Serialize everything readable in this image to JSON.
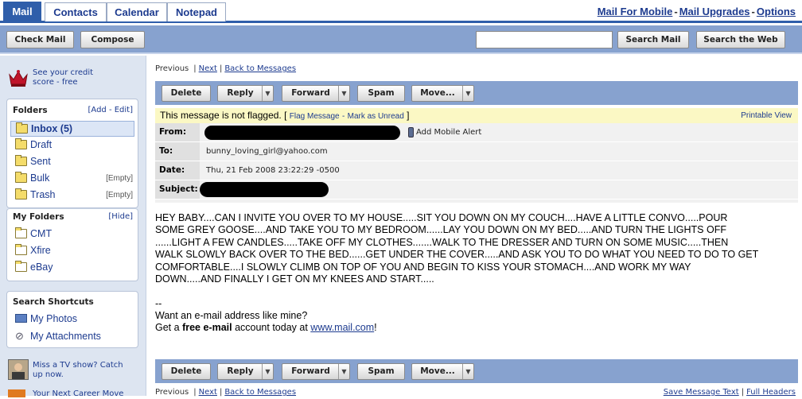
{
  "tabs": [
    "Mail",
    "Contacts",
    "Calendar",
    "Notepad"
  ],
  "top_links": {
    "mobile": "Mail For Mobile",
    "upgrades": "Mail Upgrades",
    "options": "Options",
    "sep": "-"
  },
  "toolbar": {
    "check": "Check Mail",
    "compose": "Compose",
    "search_mail": "Search Mail",
    "search_web": "Search the Web",
    "search_value": ""
  },
  "sidebar": {
    "promo_top": "See your credit score - free",
    "folders_title": "Folders",
    "folders_actions": "[Add - Edit]",
    "folders": [
      {
        "label": "Inbox (5)",
        "count": ""
      },
      {
        "label": "Draft",
        "count": ""
      },
      {
        "label": "Sent",
        "count": ""
      },
      {
        "label": "Bulk",
        "count": "[Empty]"
      },
      {
        "label": "Trash",
        "count": "[Empty]"
      }
    ],
    "my_folders_title": "My Folders",
    "my_folders_action": "[Hide]",
    "my_folders": [
      "CMT",
      "Xfire",
      "eBay"
    ],
    "shortcuts_title": "Search Shortcuts",
    "shortcuts": [
      "My Photos",
      "My Attachments"
    ],
    "promo_tv": "Miss a TV show? Catch up now.",
    "promo_career": "Your Next Career Move"
  },
  "nav": {
    "previous": "Previous",
    "next": "Next",
    "back": "Back to Messages",
    "sep": "|"
  },
  "actions": {
    "delete": "Delete",
    "reply": "Reply",
    "forward": "Forward",
    "spam": "Spam",
    "move": "Move..."
  },
  "flag": {
    "text": "This message is not flagged.",
    "open": "[",
    "flag_link": "Flag Message",
    "dash": "-",
    "unread_link": "Mark as Unread",
    "close": "]",
    "printable": "Printable View"
  },
  "headers": {
    "from_label": "From:",
    "mobile_alert": "Add Mobile Alert",
    "to_label": "To:",
    "to_value": "bunny_loving_girl@yahoo.com",
    "date_label": "Date:",
    "date_value": "Thu, 21 Feb 2008 23:22:29 -0500",
    "subject_label": "Subject:"
  },
  "body_lines": [
    "HEY BABY....CAN I INVITE YOU OVER TO MY HOUSE.....SIT YOU DOWN ON MY COUCH....HAVE A LITTLE CONVO.....POUR",
    "SOME GREY GOOSE....AND TAKE YOU TO MY BEDROOM......LAY YOU DOWN ON MY BED.....AND TURN THE LIGHTS OFF",
    "......LIGHT A FEW CANDLES.....TAKE OFF MY CLOTHES.......WALK TO THE DRESSER AND TURN ON SOME MUSIC.....THEN",
    "WALK SLOWLY BACK OVER TO THE BED......GET UNDER THE COVER.....AND ASK YOU TO DO WHAT YOU NEED TO DO TO GET",
    "COMFORTABLE....I SLOWLY CLIMB ON TOP OF YOU AND BEGIN TO KISS YOUR STOMACH....AND WORK MY WAY",
    "DOWN.....AND FINALLY I GET ON MY KNEES AND START....."
  ],
  "signature": {
    "dashes": "--",
    "line1": "Want an e-mail address like mine?",
    "get": "Get a",
    "bold": "free e-mail",
    "rest": "account today at",
    "link": "www.mail.com",
    "end": "!"
  },
  "footer": {
    "save": "Save Message Text",
    "full": "Full Headers"
  }
}
